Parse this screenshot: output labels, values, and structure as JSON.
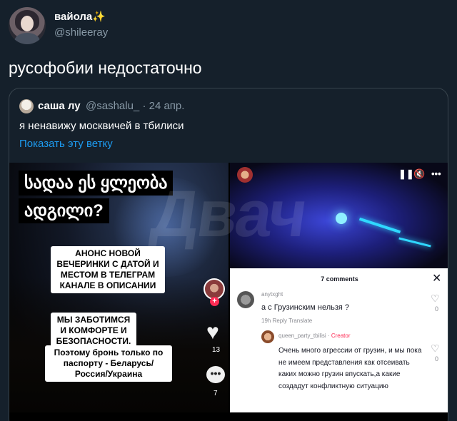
{
  "author": {
    "name": "вайола",
    "name_emoji": "✨",
    "handle": "@shileeray"
  },
  "tweet": {
    "text": "русофобии недостаточно"
  },
  "quoted": {
    "name": "саша лу",
    "handle": "@sashalu_ · 24 апр.",
    "text": "я ненавижу москвичей в тбилиси",
    "show_thread": "Показать эту ветку"
  },
  "media": {
    "watermark": "Двач",
    "left": {
      "georgian_line1": "სადაა ეს ყლეობა",
      "georgian_line2": "ადგილი?",
      "sticker1": "АНОНС НОВОЙ ВЕЧЕРИНКИ С ДАТОЙ И МЕСТОМ В ТЕЛЕГРАМ КАНАЛЕ В ОПИСАНИИ",
      "sticker2": "МЫ ЗАБОТИМСЯ И КОМФОРТЕ И БЕЗОПАСНОСТИ.",
      "sticker3": "Поэтому бронь только по паспорту - Беларусь/ Россия/Украина",
      "plus": "+",
      "likes": "13",
      "comments_count": "7",
      "comment_glyph": "•••"
    },
    "right": {
      "controls": {
        "pause": "❚❚",
        "mute": "🔇",
        "more": "•••"
      },
      "comments_title": "7 comments",
      "close": "✕",
      "comment1": {
        "user": "anytxght",
        "text": "а с Грузинским нельзя ?",
        "meta": "19h   Reply   Translate",
        "likes": "0"
      },
      "comment2": {
        "user": "queen_party_tbilisi · ",
        "badge": "Creator",
        "text": "Очень много агрессии от грузин, и мы пока не имеем представления как отсеивать каких можно грузин впускать,а какие создадут конфликтную ситуацию",
        "likes": "0"
      }
    }
  },
  "colors": {
    "background": "#15202b",
    "link": "#1d9bf0",
    "muted": "#8899a6",
    "tiktok_red": "#fe2c55"
  }
}
